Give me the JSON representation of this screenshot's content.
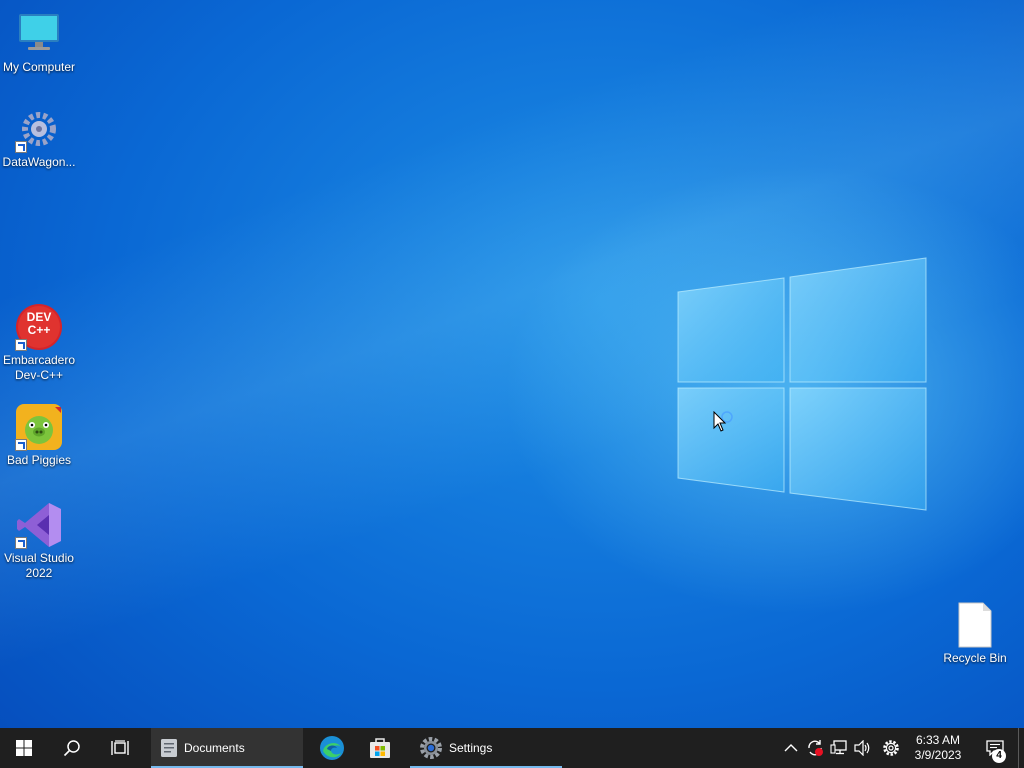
{
  "desktop": {
    "icons": [
      {
        "label": "My Computer",
        "icon": "monitor-icon"
      },
      {
        "label": "DataWagon...",
        "icon": "gear-cluster-icon"
      },
      {
        "label": "Embarcadero Dev-C++",
        "icon": "dev-cpp-icon",
        "badge_text": "DEV C++"
      },
      {
        "label": "Bad Piggies",
        "icon": "bad-piggies-icon"
      },
      {
        "label": "Visual Studio 2022",
        "icon": "visual-studio-icon"
      },
      {
        "label": "Recycle Bin",
        "icon": "blank-file-icon"
      }
    ]
  },
  "taskbar": {
    "apps": [
      {
        "label": "Documents",
        "icon": "document-icon",
        "open": true
      },
      {
        "label": "",
        "icon": "edge-icon",
        "open": false
      },
      {
        "label": "",
        "icon": "store-icon",
        "open": false
      },
      {
        "label": "Settings",
        "icon": "settings-gear-icon",
        "open": true
      }
    ],
    "tray": {
      "time": "6:33 AM",
      "date": "3/9/2023",
      "notification_count": "4"
    }
  },
  "colors": {
    "taskbar_bg": "#1f1f1f",
    "open_indicator": "#76b9ed",
    "desktop_blue": "#0a68d4"
  }
}
